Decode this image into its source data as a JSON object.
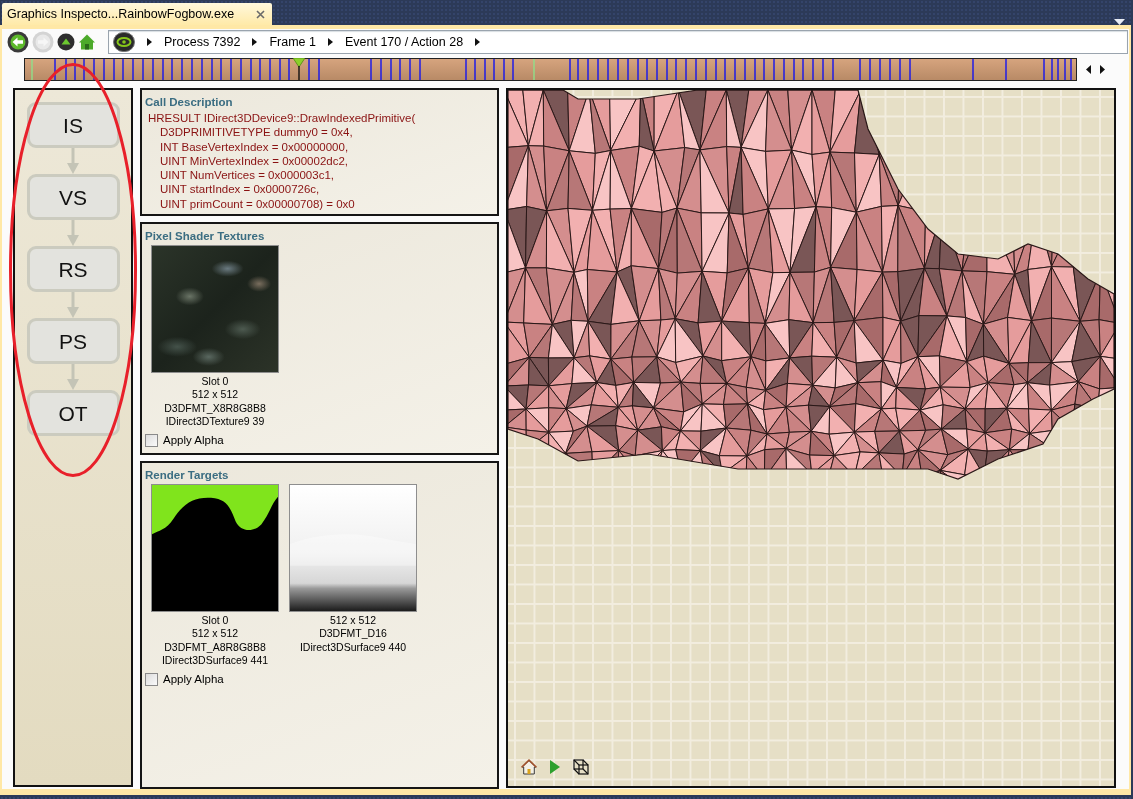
{
  "window": {
    "tab_title": "Graphics Inspecto...RainbowFogbow.exe"
  },
  "toolbar": {
    "nav_buttons": [
      {
        "kind": "back",
        "disabled": false
      },
      {
        "kind": "forward",
        "disabled": true
      },
      {
        "kind": "up",
        "disabled": false
      },
      {
        "kind": "home",
        "disabled": false
      }
    ],
    "breadcrumb": [
      "Process 7392",
      "Frame 1",
      "Event 170 / Action 28"
    ]
  },
  "pipeline": {
    "stages": [
      {
        "label": "IS",
        "selected": false
      },
      {
        "label": "VS",
        "selected": false
      },
      {
        "label": "RS",
        "selected": false
      },
      {
        "label": "PS",
        "selected": false
      },
      {
        "label": "OT",
        "selected": false
      }
    ]
  },
  "call_description": {
    "title": "Call Description",
    "signature": "HRESULT IDirect3DDevice9::DrawIndexedPrimitive(",
    "parameters": [
      "D3DPRIMITIVETYPE dummy0 = 0x4,",
      "INT BaseVertexIndex = 0x00000000,",
      "UINT MinVertexIndex = 0x00002dc2,",
      "UINT NumVertices = 0x000003c1,",
      "UINT startIndex = 0x0000726c,",
      "UINT primCount = 0x00000708) = 0x0"
    ]
  },
  "pixel_shader_textures": {
    "title": "Pixel Shader Textures",
    "items": [
      {
        "kind": "texture",
        "slot": "Slot 0",
        "size": "512 x 512",
        "format": "D3DFMT_X8R8G8B8",
        "resource": "IDirect3DTexture9 39"
      }
    ],
    "apply_alpha": {
      "label": "Apply Alpha",
      "checked": false
    }
  },
  "render_targets": {
    "title": "Render Targets",
    "items": [
      {
        "kind": "color",
        "slot": "Slot 0",
        "size": "512 x 512",
        "format": "D3DFMT_A8R8G8B8",
        "resource": "IDirect3DSurface9 441"
      },
      {
        "kind": "depth",
        "size": "512 x 512",
        "format": "D3DFMT_D16",
        "resource": "IDirect3DSurface9 440"
      }
    ],
    "apply_alpha": {
      "label": "Apply Alpha",
      "checked": false
    }
  }
}
